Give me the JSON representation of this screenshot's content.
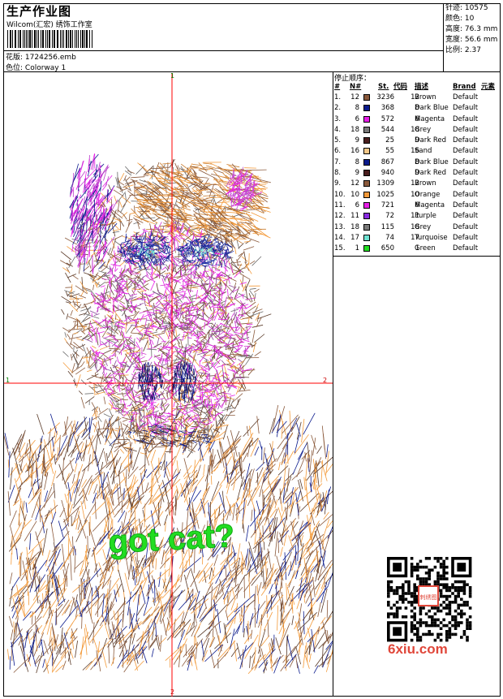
{
  "header": {
    "title": "生产作业图",
    "subtitle": "Wilcom(汇宏) 绣饰工作室",
    "design_label": "花版:",
    "design_value": "1724256.emb",
    "color_label": "色位:",
    "color_value": "Colorway 1"
  },
  "stats": [
    {
      "label": "针迹:",
      "value": "10575"
    },
    {
      "label": "颜色:",
      "value": "10"
    },
    {
      "label": "高度:",
      "value": "76.3 mm"
    },
    {
      "label": "宽度:",
      "value": "56.6 mm"
    },
    {
      "label": "比例:",
      "value": "2.37"
    }
  ],
  "axis_labels": {
    "top": "1",
    "left": "1",
    "right": "2",
    "bottom": "2"
  },
  "design_text": "got cat?",
  "stop_sequence": {
    "title": "停止顺序：",
    "headers": {
      "index": "#",
      "needle": "N#",
      "stitches": "St.",
      "code": "代码",
      "description": "描述",
      "brand": "Brand",
      "element": "元素"
    },
    "rows": [
      {
        "index": "1.",
        "needle": "12",
        "color": "#8b5a3c",
        "stitches": "3236",
        "code": "12",
        "description": "Brown",
        "brand": "Default"
      },
      {
        "index": "2.",
        "needle": "8",
        "color": "#0a1a8c",
        "stitches": "368",
        "code": "8",
        "description": "Dark Blue",
        "brand": "Default"
      },
      {
        "index": "3.",
        "needle": "6",
        "color": "#e61ee6",
        "stitches": "572",
        "code": "6",
        "description": "Magenta",
        "brand": "Default"
      },
      {
        "index": "4.",
        "needle": "18",
        "color": "#7a7a7a",
        "stitches": "544",
        "code": "18",
        "description": "Grey",
        "brand": "Default"
      },
      {
        "index": "5.",
        "needle": "9",
        "color": "#4a1e1e",
        "stitches": "25",
        "code": "9",
        "description": "Dark Red",
        "brand": "Default"
      },
      {
        "index": "6.",
        "needle": "16",
        "color": "#f5c98a",
        "stitches": "55",
        "code": "16",
        "description": "Sand",
        "brand": "Default"
      },
      {
        "index": "7.",
        "needle": "8",
        "color": "#0a1a8c",
        "stitches": "867",
        "code": "8",
        "description": "Dark Blue",
        "brand": "Default"
      },
      {
        "index": "8.",
        "needle": "9",
        "color": "#4a1e1e",
        "stitches": "940",
        "code": "9",
        "description": "Dark Red",
        "brand": "Default"
      },
      {
        "index": "9.",
        "needle": "12",
        "color": "#8b5a3c",
        "stitches": "1309",
        "code": "12",
        "description": "Brown",
        "brand": "Default"
      },
      {
        "index": "10.",
        "needle": "10",
        "color": "#f39a3a",
        "stitches": "1025",
        "code": "10",
        "description": "Orange",
        "brand": "Default"
      },
      {
        "index": "11.",
        "needle": "6",
        "color": "#e61ee6",
        "stitches": "721",
        "code": "6",
        "description": "Magenta",
        "brand": "Default"
      },
      {
        "index": "12.",
        "needle": "11",
        "color": "#8a2be2",
        "stitches": "72",
        "code": "11",
        "description": "Purple",
        "brand": "Default"
      },
      {
        "index": "13.",
        "needle": "18",
        "color": "#7a7a7a",
        "stitches": "115",
        "code": "18",
        "description": "Grey",
        "brand": "Default"
      },
      {
        "index": "14.",
        "needle": "17",
        "color": "#6fe3d3",
        "stitches": "74",
        "code": "17",
        "description": "Turquoise",
        "brand": "Default"
      },
      {
        "index": "15.",
        "needle": "1",
        "color": "#22dd22",
        "stitches": "650",
        "code": "1",
        "description": "Green",
        "brand": "Default"
      }
    ]
  },
  "watermark": {
    "text": "6xiu.com",
    "stamp_text": "刺绣图"
  },
  "colors": {
    "crosshair": "#ff0000",
    "orange": "#f39a3a",
    "brown": "#8b5a3c",
    "magenta": "#e61ee6",
    "dark_blue": "#0a1a8c",
    "green": "#22dd22"
  }
}
